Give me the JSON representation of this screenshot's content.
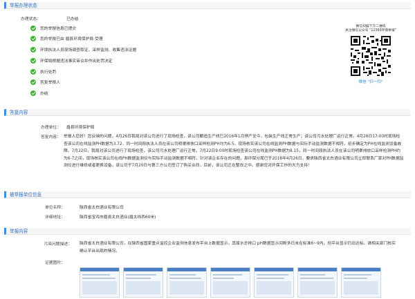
{
  "sections": {
    "status": "举报办理状态",
    "reply": "答复内容",
    "reported_unit": "被举报单位信息",
    "report_content": "举报内容"
  },
  "status": {
    "label": "办理状态：",
    "value": "已办结",
    "steps": [
      "您的举报信息已提交",
      "您的举报已由 眉县环境保护局 受理",
      "环境执法人员现场调查取证、采样监测、收集违法证据",
      "环保局根据违法事实审议并作出处罚决定",
      "执行处罚",
      "答复举报人",
      "办结"
    ]
  },
  "qr": {
    "line1": "微信扫描下方二维码",
    "line2": "关注微信公众号 \"12369环保举报\"",
    "caption": "微信 \"扫一扫\""
  },
  "reply": {
    "unit_label": "办理单位：",
    "unit_value": "眉县环境保护局",
    "content_label": "答复内容：",
    "content_value": "举报人您好！您反映的问题，4月26日我局对该公司进行了现场检查，该公司酿造生产线已2016年1月停产至今，包装生产线正常生产；该公司污水处理厂运行正常。4月26日17:00时现场检查该公司在线监测PH数据为3.72，同一时间段执法人员在该公司明渠排放口采样检测PH均为6.5，现场核实该公司在线监测PH数据与实际手动监测数据不相符。初步确定为PH在线监测设备故障。7月22日，我局对该公司进行了现场检查，该公司污水处理厂运行正常。7月22日9:00时现场检查该公司在线监测PH数据为8.15，同一时间段执法人员在该公司明渠排放口采样检测PH约为6-7之间，现场核实该公司在线PH数据监测仪与实际手动监测数据不相符。针对该企业存在的问题，县环保分局已于2018年4月26日，要求陕西省太白酒业有限公司立即联系厂家对PH数据监测仪进行维修或者更换设备。该公司于7月20日与第三方公司签订了购买合同，目前，该公司正在整改之中。感谢您对环保工作的大力支持！"
  },
  "reported_unit": {
    "name_label": "单位名称：",
    "name_value": "陕西省太白酒业有限公司",
    "addr_label": "详细地址：",
    "addr_value": "陕西省宝鸡市眉县太白酒业(眉太线西60米)"
  },
  "report_content": {
    "desc_label": "污染问题描述：",
    "desc_value": "陕西省太白酒业有限公司，在陕西省国家重点监控企业监测信息发布平台上数据显示，其废水总排口 pH数据显示间断多日未在标准6~9内，但平台显示仍旧达标。请相关部门核实确认平台出现的情况。",
    "evidence_label": "证据图片："
  },
  "colors": {
    "accent": "#2b6fc2",
    "check": "#3fb332",
    "qr_caption": "#2b8fe0"
  }
}
